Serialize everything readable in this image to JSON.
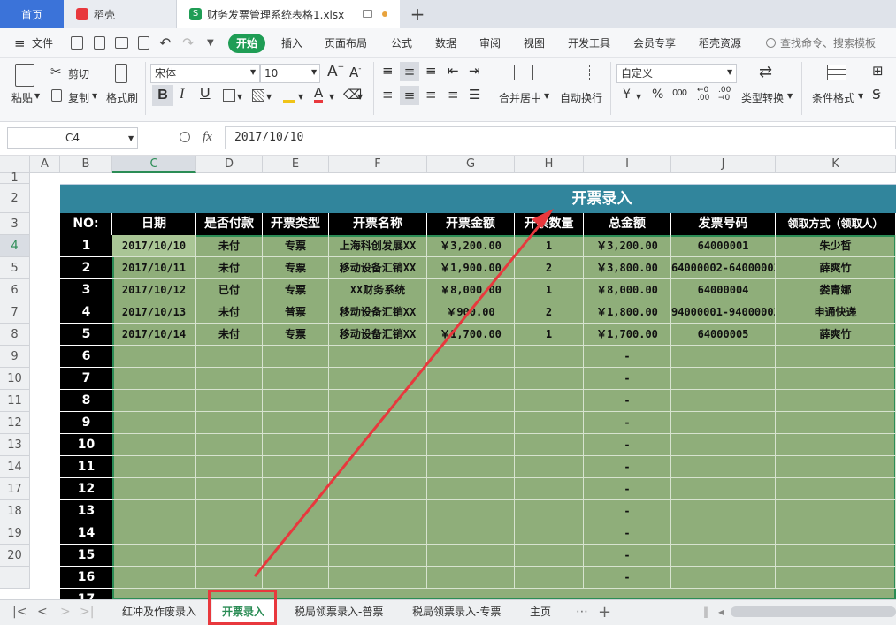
{
  "tabs": {
    "home": "首页",
    "daoke": "稻壳",
    "file": "财务发票管理系统表格1.xlsx",
    "new_tab": "+"
  },
  "menu": {
    "file": "文件",
    "items": [
      "开始",
      "插入",
      "页面布局",
      "公式",
      "数据",
      "审阅",
      "视图",
      "开发工具",
      "会员专享",
      "稻壳资源"
    ],
    "search_placeholder": "查找命令、搜索模板"
  },
  "ribbon": {
    "paste": "粘贴",
    "cut": "剪切",
    "copy": "复制",
    "format_painter": "格式刷",
    "font_name": "宋体",
    "font_size": "10",
    "merge_center": "合并居中",
    "wrap_text": "自动换行",
    "number_format": "自定义",
    "type_convert": "类型转换",
    "conditional_format": "条件格式",
    "currency_symbol": "¥",
    "percent_symbol": "%",
    "thousands": "000"
  },
  "formula_bar": {
    "cell_ref": "C4",
    "fx": "fx",
    "value": "2017/10/10"
  },
  "columns": [
    "A",
    "B",
    "C",
    "D",
    "E",
    "F",
    "G",
    "H",
    "I",
    "J",
    "K"
  ],
  "row_numbers": [
    "1",
    "2",
    "3",
    "4",
    "5",
    "6",
    "7",
    "8",
    "9",
    "10",
    "11",
    "12",
    "13",
    "14",
    "17",
    "18",
    "19",
    "20"
  ],
  "sheet": {
    "title": "开票录入",
    "headers": [
      "NO:",
      "日期",
      "是否付款",
      "开票类型",
      "开票名称",
      "开票金额",
      "开票数量",
      "总金额",
      "发票号码",
      "领取方式（领取人）"
    ],
    "rows": [
      {
        "no": "1",
        "date": "2017/10/10",
        "paid": "未付",
        "type": "专票",
        "name": "上海科创发展XX",
        "amount": "￥3,200.00",
        "qty": "1",
        "total": "￥3,200.00",
        "invoice": "64000001",
        "recipient": "朱少皙"
      },
      {
        "no": "2",
        "date": "2017/10/11",
        "paid": "未付",
        "type": "专票",
        "name": "移动设备汇销XX",
        "amount": "￥1,900.00",
        "qty": "2",
        "total": "￥3,800.00",
        "invoice": "64000002-64000003",
        "recipient": "薛爽竹"
      },
      {
        "no": "3",
        "date": "2017/10/12",
        "paid": "已付",
        "type": "专票",
        "name": "XX财务系统",
        "amount": "￥8,000.00",
        "qty": "1",
        "total": "￥8,000.00",
        "invoice": "64000004",
        "recipient": "娄青娜"
      },
      {
        "no": "4",
        "date": "2017/10/13",
        "paid": "未付",
        "type": "普票",
        "name": "移动设备汇销XX",
        "amount": "￥900.00",
        "qty": "2",
        "total": "￥1,800.00",
        "invoice": "94000001-94000002",
        "recipient": "申通快递"
      },
      {
        "no": "5",
        "date": "2017/10/14",
        "paid": "未付",
        "type": "专票",
        "name": "移动设备汇销XX",
        "amount": "￥1,700.00",
        "qty": "1",
        "total": "￥1,700.00",
        "invoice": "64000005",
        "recipient": "薛爽竹"
      }
    ],
    "empty_rows": [
      {
        "no": "6",
        "total": "-"
      },
      {
        "no": "7",
        "total": "-"
      },
      {
        "no": "8",
        "total": "-"
      },
      {
        "no": "9",
        "total": "-"
      },
      {
        "no": "10",
        "total": "-"
      },
      {
        "no": "11",
        "total": "-"
      },
      {
        "no": "12",
        "total": "-"
      },
      {
        "no": "13",
        "total": "-"
      },
      {
        "no": "14",
        "total": "-"
      },
      {
        "no": "15",
        "total": "-"
      },
      {
        "no": "16",
        "total": "-"
      },
      {
        "no": "17",
        "total": ""
      }
    ]
  },
  "sheet_tabs": [
    "红冲及作废录入",
    "开票录入",
    "税局领票录入-普票",
    "税局领票录入-专票",
    "主页"
  ],
  "active_sheet": "开票录入",
  "colors": {
    "title_bar": "#31859c",
    "data_fill": "#8fae7a",
    "accent_green": "#2b8c55",
    "annotation_red": "#e8383d"
  }
}
